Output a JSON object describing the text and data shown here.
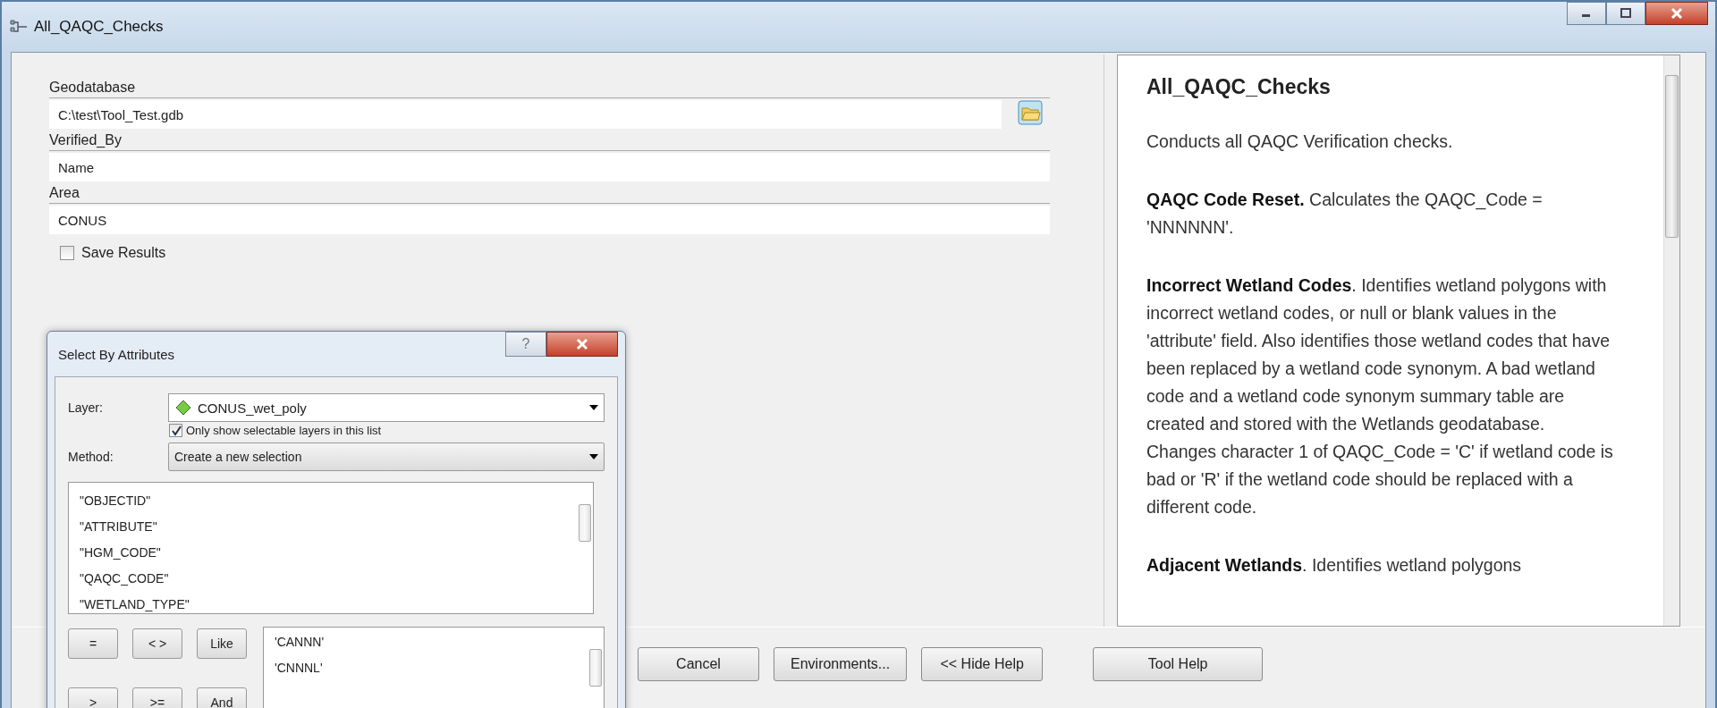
{
  "window": {
    "title": "All_QAQC_Checks"
  },
  "parameters": [
    {
      "kind": "text",
      "label": "Geodatabase",
      "value": "C:\\test\\Tool_Test.gdb",
      "browse": true
    },
    {
      "kind": "text",
      "label": "Verified_By",
      "value": "Name",
      "browse": false
    },
    {
      "kind": "text",
      "label": "Area",
      "value": "CONUS",
      "browse": false
    },
    {
      "kind": "checkbox",
      "label": "Save Results",
      "checked": false
    }
  ],
  "buttons": [
    "Cancel",
    "Environments...",
    "<< Hide Help"
  ],
  "help": {
    "title": "All_QAQC_Checks",
    "tool_help_button": "Tool Help",
    "paragraphs": [
      "Conducts all QAQC Verification checks.",
      "**QAQC Code Reset.** Calculates the QAQC_Code = 'NNNNNN'.",
      "**Incorrect Wetland Codes**. Identifies wetland polygons with incorrect wetland codes, or null or blank values in the 'attribute' field. Also identifies those wetland codes that have been replaced by a wetland code synonym. A bad wetland code and a wetland code synonym summary table are created and stored with the Wetlands geodatabase. Changes character 1 of QAQC_Code = 'C' if wetland code is bad or 'R' if the wetland code should be replaced with a different code.",
      "**Adjacent Wetlands**. Identifies wetland polygons"
    ]
  },
  "dialog": {
    "title": "Select By Attributes",
    "help_button": "?",
    "layer_label": "Layer:",
    "layer": "CONUS_wet_poly",
    "only_selectable": {
      "label": "Only show selectable layers in this list",
      "checked": true
    },
    "method_label": "Method:",
    "method": "Create a new selection",
    "fields": [
      "\"OBJECTID\"",
      "\"ATTRIBUTE\"",
      "\"HGM_CODE\"",
      "\"QAQC_CODE\"",
      "\"WETLAND_TYPE\""
    ],
    "operators": [
      "=",
      "< >",
      "Like",
      ">",
      ">=",
      "And"
    ],
    "values": [
      "'CANNN'",
      "'CNNNL'"
    ]
  }
}
